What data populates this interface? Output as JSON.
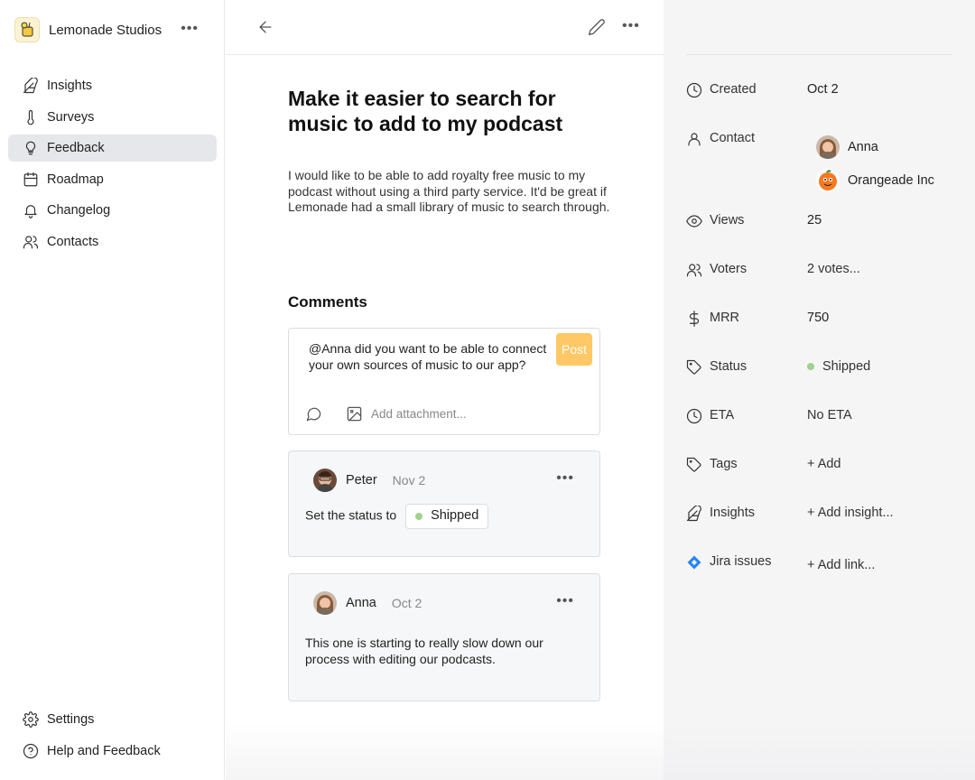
{
  "workspace": {
    "name": "Lemonade Studios"
  },
  "nav": {
    "items": [
      {
        "label": "Insights",
        "icon": "feather-icon"
      },
      {
        "label": "Surveys",
        "icon": "thermometer-icon"
      },
      {
        "label": "Feedback",
        "icon": "lightbulb-icon",
        "active": true
      },
      {
        "label": "Roadmap",
        "icon": "calendar-icon"
      },
      {
        "label": "Changelog",
        "icon": "bell-icon"
      },
      {
        "label": "Contacts",
        "icon": "users-icon"
      }
    ],
    "bottom": [
      {
        "label": "Settings",
        "icon": "gear-icon"
      },
      {
        "label": "Help and Feedback",
        "icon": "help-circle-icon"
      }
    ]
  },
  "feedback": {
    "title": "Make it easier to search for music to add to my podcast",
    "description": "I would like to be able to add royalty free music to my podcast without using a third party service. It'd be great if Lemonade had a small library of music to search through."
  },
  "comments": {
    "heading": "Comments",
    "composer": {
      "text": "@Anna did you want to be able to connect your own sources of music to our app?",
      "post_label": "Post",
      "attachment_label": "Add attachment..."
    },
    "items": [
      {
        "author": "Peter",
        "date": "Nov 2",
        "text": "Set the status to",
        "status": "Shipped"
      },
      {
        "author": "Anna",
        "date": "Oct 2",
        "text": "This one is starting to really slow down our process with editing our podcasts."
      }
    ]
  },
  "properties": {
    "created": {
      "label": "Created",
      "value": "Oct 2"
    },
    "contact": {
      "label": "Contact",
      "people": [
        "Anna",
        "Orangeade Inc"
      ]
    },
    "views": {
      "label": "Views",
      "value": "25"
    },
    "voters": {
      "label": "Voters",
      "value": "2 votes..."
    },
    "mrr": {
      "label": "MRR",
      "value": "750"
    },
    "status": {
      "label": "Status",
      "value": "Shipped",
      "color": "#9ed28d"
    },
    "eta": {
      "label": "ETA",
      "value": "No ETA"
    },
    "tags": {
      "label": "Tags",
      "value": "+ Add"
    },
    "insights": {
      "label": "Insights",
      "value": "+ Add insight..."
    },
    "jira": {
      "label": "Jira issues",
      "value": "+ Add link..."
    }
  },
  "colors": {
    "accent": "#fdc865",
    "status_shipped": "#9ed28d",
    "jira": "#2684ff"
  }
}
